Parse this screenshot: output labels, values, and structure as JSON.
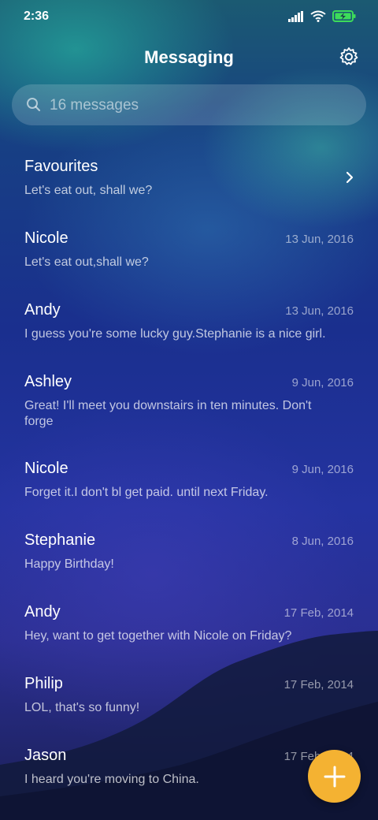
{
  "status_bar": {
    "time": "2:36",
    "icons": [
      "signal-icon",
      "wifi-icon",
      "battery-charging-icon"
    ],
    "battery_color": "#3ddc5a"
  },
  "header": {
    "title": "Messaging",
    "settings_icon": "gear-icon"
  },
  "search": {
    "placeholder": "16 messages",
    "icon": "search-icon"
  },
  "favourites": {
    "name": "Favourites",
    "preview": "Let's eat out, shall we?"
  },
  "conversations": [
    {
      "name": "Nicole",
      "date": "13 Jun, 2016",
      "preview": "Let's eat out,shall we?"
    },
    {
      "name": "Andy",
      "date": "13 Jun, 2016",
      "preview": "I guess you're some lucky guy.Stephanie is a nice girl."
    },
    {
      "name": "Ashley",
      "date": "9 Jun, 2016",
      "preview": "Great! I'll meet you downstairs in ten minutes. Don't forge"
    },
    {
      "name": "Nicole",
      "date": "9 Jun, 2016",
      "preview": "Forget it.I don't bl get paid. until next Friday."
    },
    {
      "name": "Stephanie",
      "date": "8 Jun, 2016",
      "preview": "Happy Birthday!"
    },
    {
      "name": "Andy",
      "date": "17 Feb, 2014",
      "preview": "Hey, want to get together with Nicole on Friday?"
    },
    {
      "name": "Philip",
      "date": "17 Feb, 2014",
      "preview": "LOL, that's so funny!"
    },
    {
      "name": "Jason",
      "date": "17 Feb, 2014",
      "preview": "I heard you're moving to China."
    }
  ],
  "fab": {
    "icon": "plus-icon",
    "color": "#f4b232"
  }
}
